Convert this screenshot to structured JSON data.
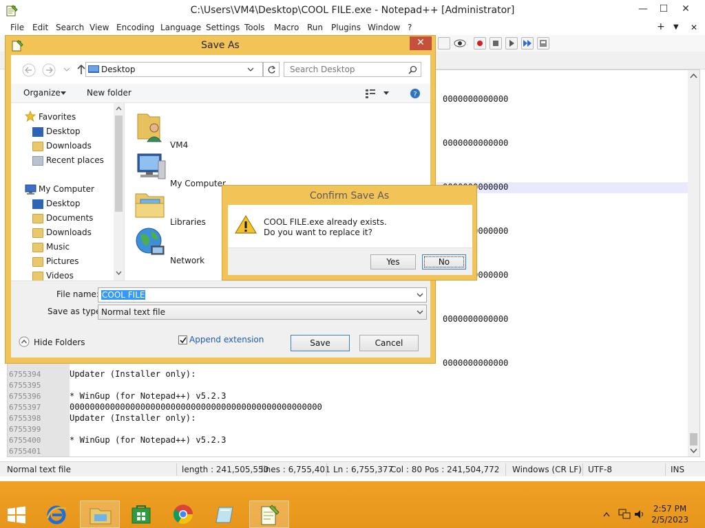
{
  "window": {
    "title": "C:\\Users\\VM4\\Desktop\\COOL FILE.exe - Notepad++ [Administrator]",
    "minimize": "—",
    "maximize": "☐",
    "close": "✕"
  },
  "menu": [
    "File",
    "Edit",
    "Search",
    "View",
    "Encoding",
    "Language",
    "Settings",
    "Tools",
    "Macro",
    "Run",
    "Plugins",
    "Window",
    "?"
  ],
  "menu_right": {
    "plus": "+",
    "dropdown": "▼",
    "close": "✕"
  },
  "editor": {
    "visible_fragments": [
      "0000000000000",
      "0000000000000",
      "0000000000000",
      "0000000000000",
      "0000000000000",
      "0000000000000",
      "0000000000000"
    ],
    "lines": [
      {
        "num": "6755394",
        "text": "Updater (Installer only):"
      },
      {
        "num": "6755395",
        "text": ""
      },
      {
        "num": "6755396",
        "text": "* WinGup (for Notepad++) v5.2.3"
      },
      {
        "num": "6755397",
        "text": "00000000000000000000000000000000000000000000000000"
      },
      {
        "num": "6755398",
        "text": "Updater (Installer only):"
      },
      {
        "num": "6755399",
        "text": ""
      },
      {
        "num": "6755400",
        "text": "* WinGup (for Notepad++) v5.2.3"
      },
      {
        "num": "6755401",
        "text": ""
      }
    ]
  },
  "status": {
    "filetype": "Normal text file",
    "length": "length : 241,505,550",
    "lines": "lines : 6,755,401",
    "ln": "Ln : 6,755,377",
    "col": "Col : 80",
    "pos": "Pos : 241,504,772",
    "eol": "Windows (CR LF)",
    "encoding": "UTF-8",
    "mode": "INS"
  },
  "save_as": {
    "title": "Save As",
    "address": "Desktop",
    "search_placeholder": "Search Desktop",
    "organize": "Organize",
    "new_folder": "New folder",
    "nav": {
      "favorites": "Favorites",
      "fav_items": [
        "Desktop",
        "Downloads",
        "Recent places"
      ],
      "computer": "My Computer",
      "comp_items": [
        "Desktop",
        "Documents",
        "Downloads",
        "Music",
        "Pictures",
        "Videos"
      ]
    },
    "items": [
      "VM4",
      "My Computer",
      "Libraries",
      "Network"
    ],
    "file_name_label": "File name:",
    "file_name_value": "COOL FILE",
    "save_as_type_label": "Save as type:",
    "save_as_type_value": "Normal text file",
    "hide_folders": "Hide Folders",
    "append_extension": "Append extension",
    "save": "Save",
    "cancel": "Cancel"
  },
  "confirm": {
    "title": "Confirm Save As",
    "line1": "COOL FILE.exe already exists.",
    "line2": "Do you want to replace it?",
    "yes": "Yes",
    "no": "No"
  },
  "taskbar": {
    "time": "2:57 PM",
    "date": "2/5/2023"
  },
  "colors": {
    "accent_border": "#f2c356",
    "taskbar": "#e6961a",
    "selection": "#3399ff",
    "close_red": "#c7503a"
  }
}
